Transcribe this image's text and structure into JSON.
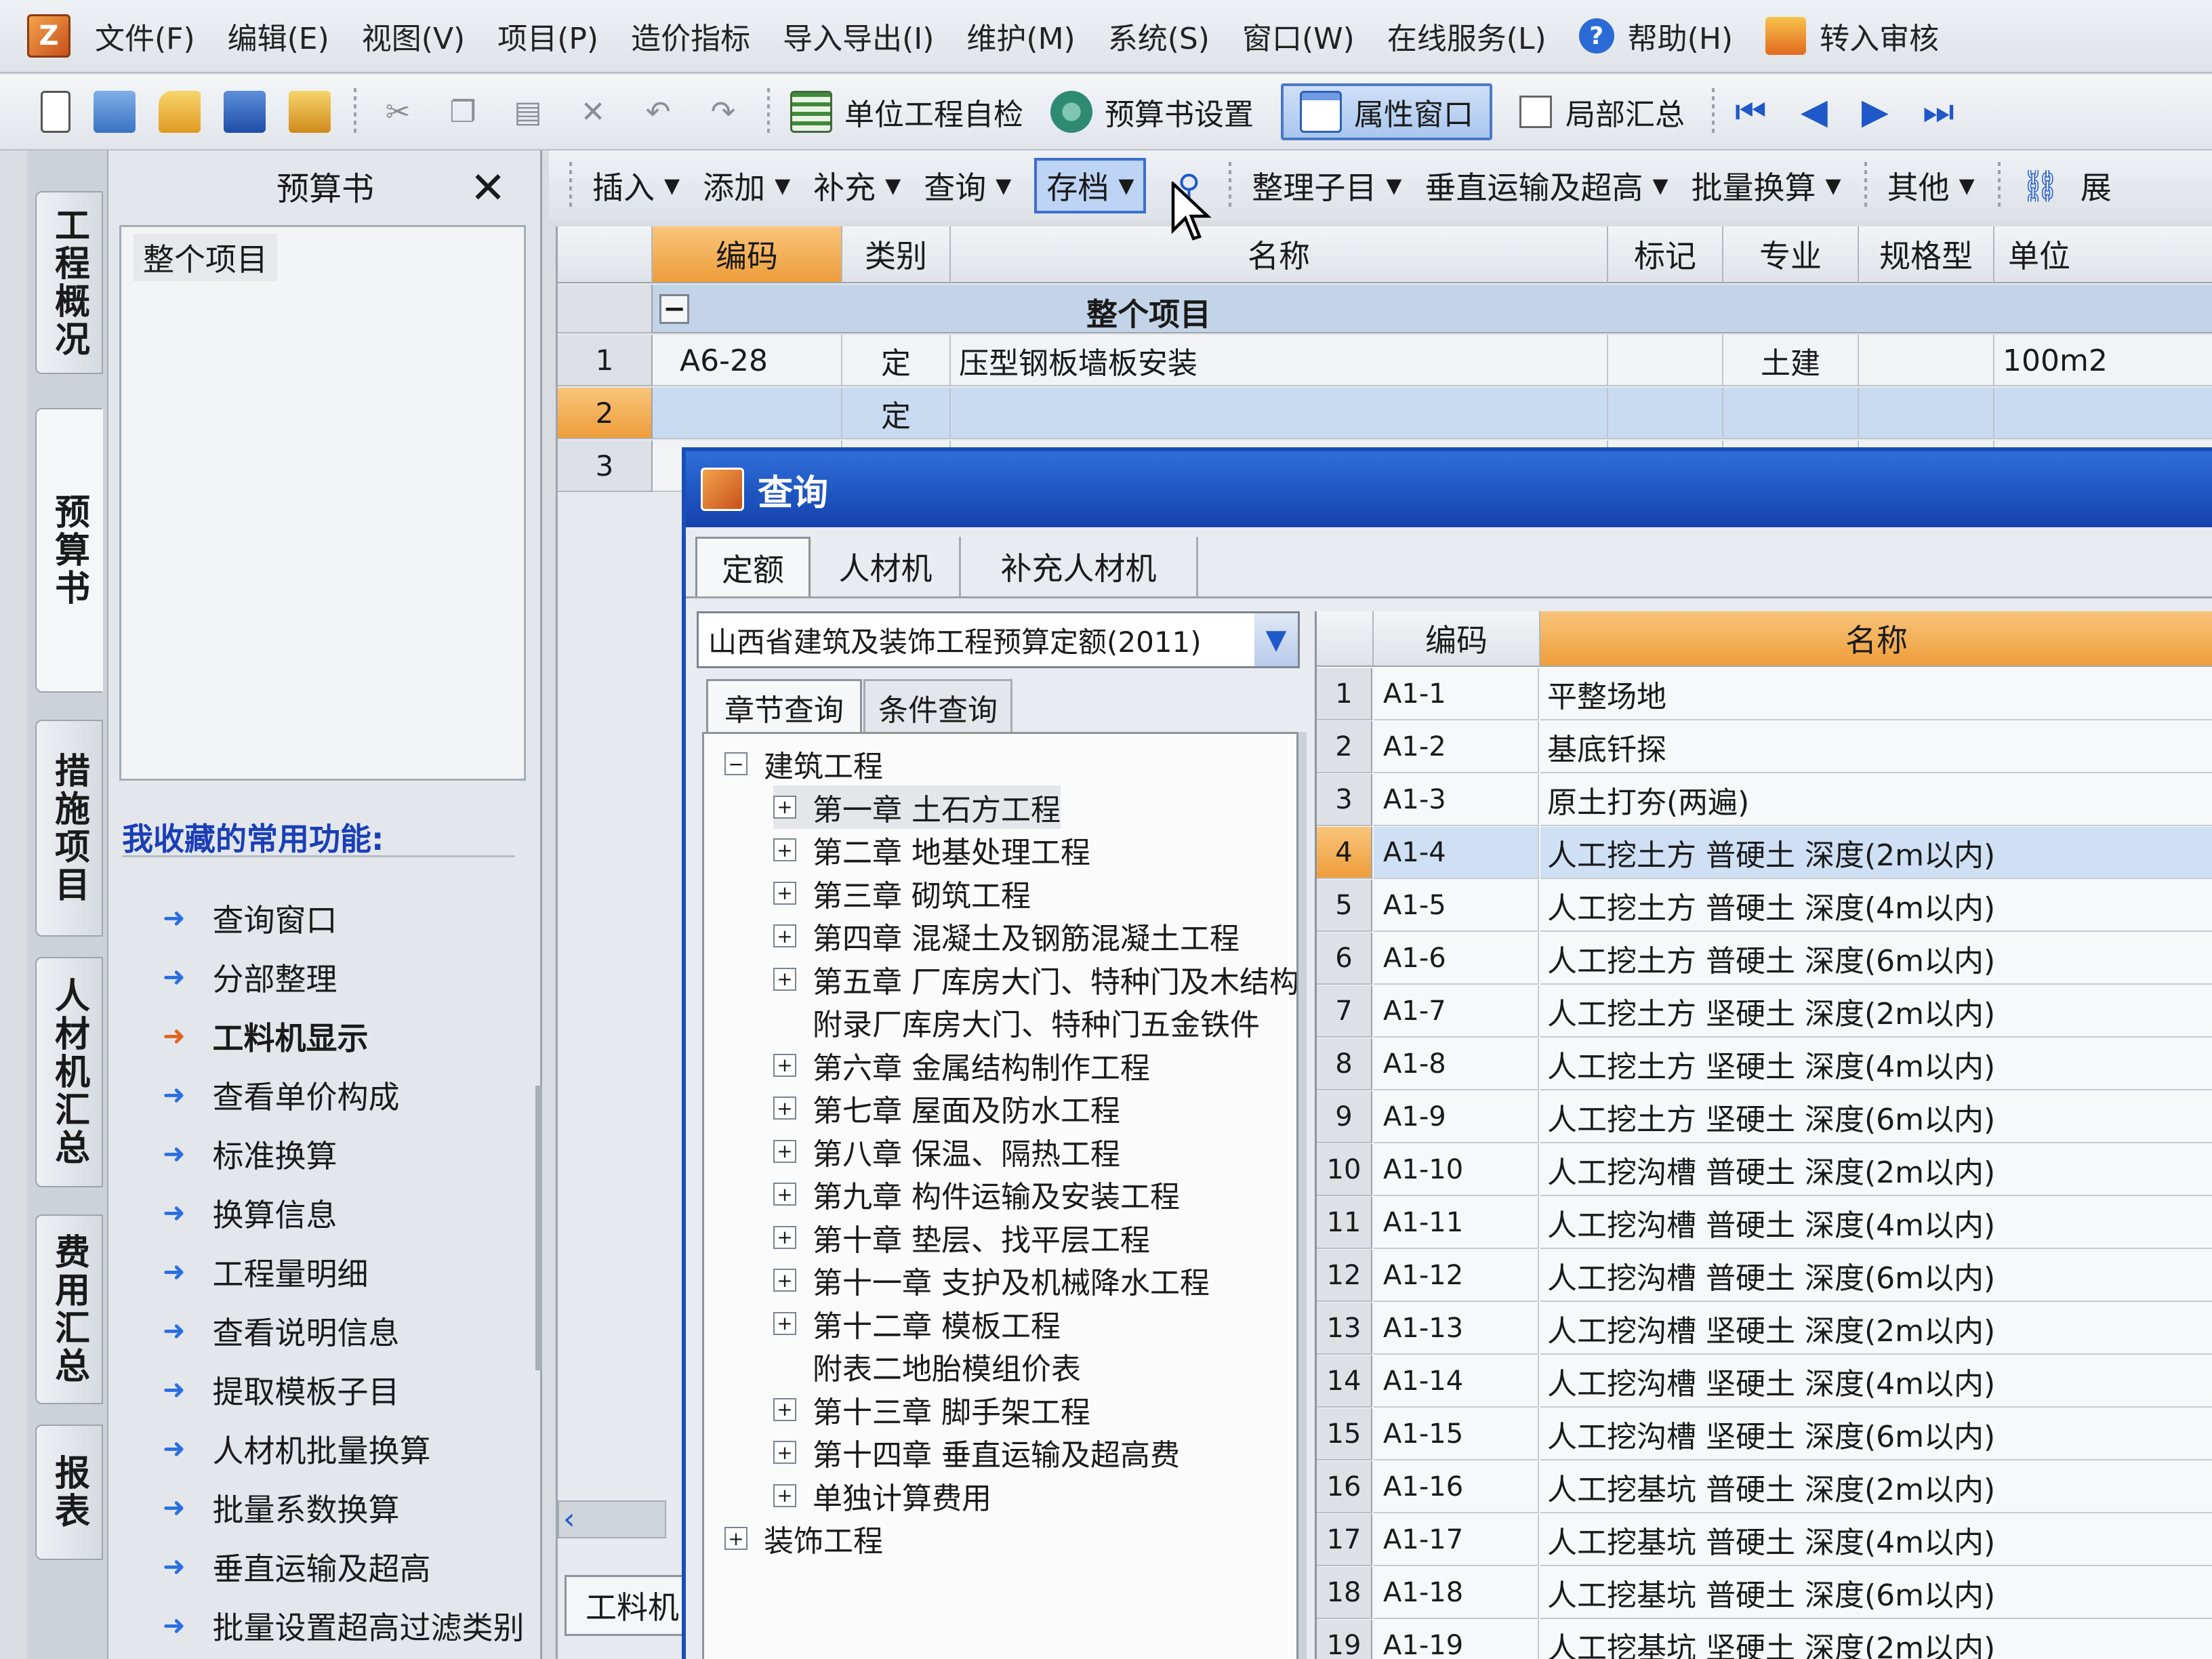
{
  "app": {
    "logo_char": "Z",
    "menu": [
      "文件(F)",
      "编辑(E)",
      "视图(V)",
      "项目(P)",
      "造价指标",
      "导入导出(I)",
      "维护(M)",
      "系统(S)",
      "窗口(W)",
      "在线服务(L)"
    ],
    "help_label": "帮助(H)",
    "submit_label": "转入审核"
  },
  "toolbar": {
    "unit_check": "单位工程自检",
    "budget_settings": "预算书设置",
    "property_window": "属性窗口",
    "partial_summary": "局部汇总"
  },
  "vtabs": [
    "工程概况",
    "预算书",
    "措施项目",
    "人材机汇总",
    "费用汇总",
    "报表"
  ],
  "left_panel": {
    "title": "预算书",
    "tree_root": "整个项目",
    "favorites_title": "我收藏的常用功能:",
    "favorites": [
      "查询窗口",
      "分部整理",
      "工料机显示",
      "查看单价构成",
      "标准换算",
      "换算信息",
      "工程量明细",
      "查看说明信息",
      "提取模板子目",
      "人材机批量换算",
      "批量系数换算",
      "垂直运输及超高",
      "批量设置超高过滤类别"
    ]
  },
  "subtoolbar": {
    "buttons": [
      "插入",
      "添加",
      "补充",
      "查询",
      "存档"
    ],
    "buttons2": [
      "整理子目",
      "垂直运输及超高",
      "批量换算",
      "其他"
    ],
    "last": "展"
  },
  "main_grid": {
    "headers": [
      "编码",
      "类别",
      "名称",
      "标记",
      "专业",
      "规格型",
      "单位"
    ],
    "group_title": "整个项目",
    "rows": [
      {
        "num": "1",
        "code": "A6-28",
        "type": "定",
        "name": "压型钢板墙板安装",
        "mark": "",
        "major": "土建",
        "spec": "",
        "unit": "100m2"
      },
      {
        "num": "2",
        "code": "",
        "type": "定",
        "name": "",
        "mark": "",
        "major": "",
        "spec": "",
        "unit": ""
      },
      {
        "num": "3",
        "code": "",
        "type": "",
        "name": "",
        "mark": "",
        "major": "",
        "spec": "",
        "unit": ""
      }
    ],
    "bottom_tab": "工料机"
  },
  "dialog": {
    "title": "查询",
    "tabs": [
      "定额",
      "人材机",
      "补充人材机"
    ],
    "quota_select": "山西省建筑及装饰工程预算定额(2011)",
    "sub_tabs": [
      "章节查询",
      "条件查询"
    ],
    "tree": [
      {
        "label": "建筑工程",
        "level": 0,
        "box": "⊟"
      },
      {
        "label": "第一章  土石方工程",
        "level": 1,
        "box": "⊞",
        "hl": true
      },
      {
        "label": "第二章  地基处理工程",
        "level": 1,
        "box": "⊞"
      },
      {
        "label": "第三章  砌筑工程",
        "level": 1,
        "box": "⊞"
      },
      {
        "label": "第四章  混凝土及钢筋混凝土工程",
        "level": 1,
        "box": "⊞"
      },
      {
        "label": "第五章  厂库房大门、特种门及木结构工程",
        "level": 1,
        "box": "⊞"
      },
      {
        "label": "附录厂库房大门、特种门五金铁件",
        "level": 1,
        "box": ""
      },
      {
        "label": "第六章  金属结构制作工程",
        "level": 1,
        "box": "⊞"
      },
      {
        "label": "第七章  屋面及防水工程",
        "level": 1,
        "box": "⊞"
      },
      {
        "label": "第八章  保温、隔热工程",
        "level": 1,
        "box": "⊞"
      },
      {
        "label": "第九章  构件运输及安装工程",
        "level": 1,
        "box": "⊞"
      },
      {
        "label": "第十章  垫层、找平层工程",
        "level": 1,
        "box": "⊞"
      },
      {
        "label": "第十一章  支护及机械降水工程",
        "level": 1,
        "box": "⊞"
      },
      {
        "label": "第十二章  模板工程",
        "level": 1,
        "box": "⊞"
      },
      {
        "label": "附表二地胎模组价表",
        "level": 1,
        "box": ""
      },
      {
        "label": "第十三章  脚手架工程",
        "level": 1,
        "box": "⊞"
      },
      {
        "label": "第十四章  垂直运输及超高费",
        "level": 1,
        "box": "⊞"
      },
      {
        "label": "单独计算费用",
        "level": 1,
        "box": "⊞"
      },
      {
        "label": "装饰工程",
        "level": 0,
        "box": "⊞"
      }
    ],
    "grid_headers": [
      "编码",
      "名称"
    ],
    "quota_rows": [
      {
        "num": "1",
        "code": "A1-1",
        "name": "平整场地"
      },
      {
        "num": "2",
        "code": "A1-2",
        "name": "基底钎探"
      },
      {
        "num": "3",
        "code": "A1-3",
        "name": "原土打夯(两遍)"
      },
      {
        "num": "4",
        "code": "A1-4",
        "name": "人工挖土方  普硬土  深度(2m以内)"
      },
      {
        "num": "5",
        "code": "A1-5",
        "name": "人工挖土方  普硬土  深度(4m以内)"
      },
      {
        "num": "6",
        "code": "A1-6",
        "name": "人工挖土方  普硬土  深度(6m以内)"
      },
      {
        "num": "7",
        "code": "A1-7",
        "name": "人工挖土方  坚硬土  深度(2m以内)"
      },
      {
        "num": "8",
        "code": "A1-8",
        "name": "人工挖土方  坚硬土  深度(4m以内)"
      },
      {
        "num": "9",
        "code": "A1-9",
        "name": "人工挖土方  坚硬土  深度(6m以内)"
      },
      {
        "num": "10",
        "code": "A1-10",
        "name": "人工挖沟槽  普硬土  深度(2m以内)"
      },
      {
        "num": "11",
        "code": "A1-11",
        "name": "人工挖沟槽  普硬土  深度(4m以内)"
      },
      {
        "num": "12",
        "code": "A1-12",
        "name": "人工挖沟槽  普硬土  深度(6m以内)"
      },
      {
        "num": "13",
        "code": "A1-13",
        "name": "人工挖沟槽  坚硬土  深度(2m以内)"
      },
      {
        "num": "14",
        "code": "A1-14",
        "name": "人工挖沟槽  坚硬土  深度(4m以内)"
      },
      {
        "num": "15",
        "code": "A1-15",
        "name": "人工挖沟槽  坚硬土  深度(6m以内)"
      },
      {
        "num": "16",
        "code": "A1-16",
        "name": "人工挖基坑  普硬土  深度(2m以内)"
      },
      {
        "num": "17",
        "code": "A1-17",
        "name": "人工挖基坑  普硬土  深度(4m以内)"
      },
      {
        "num": "18",
        "code": "A1-18",
        "name": "人工挖基坑  普硬土  深度(6m以内)"
      },
      {
        "num": "19",
        "code": "A1-19",
        "name": "人工挖基坑  坚硬土  深度(2m以内)"
      }
    ],
    "selected_row": "4"
  }
}
